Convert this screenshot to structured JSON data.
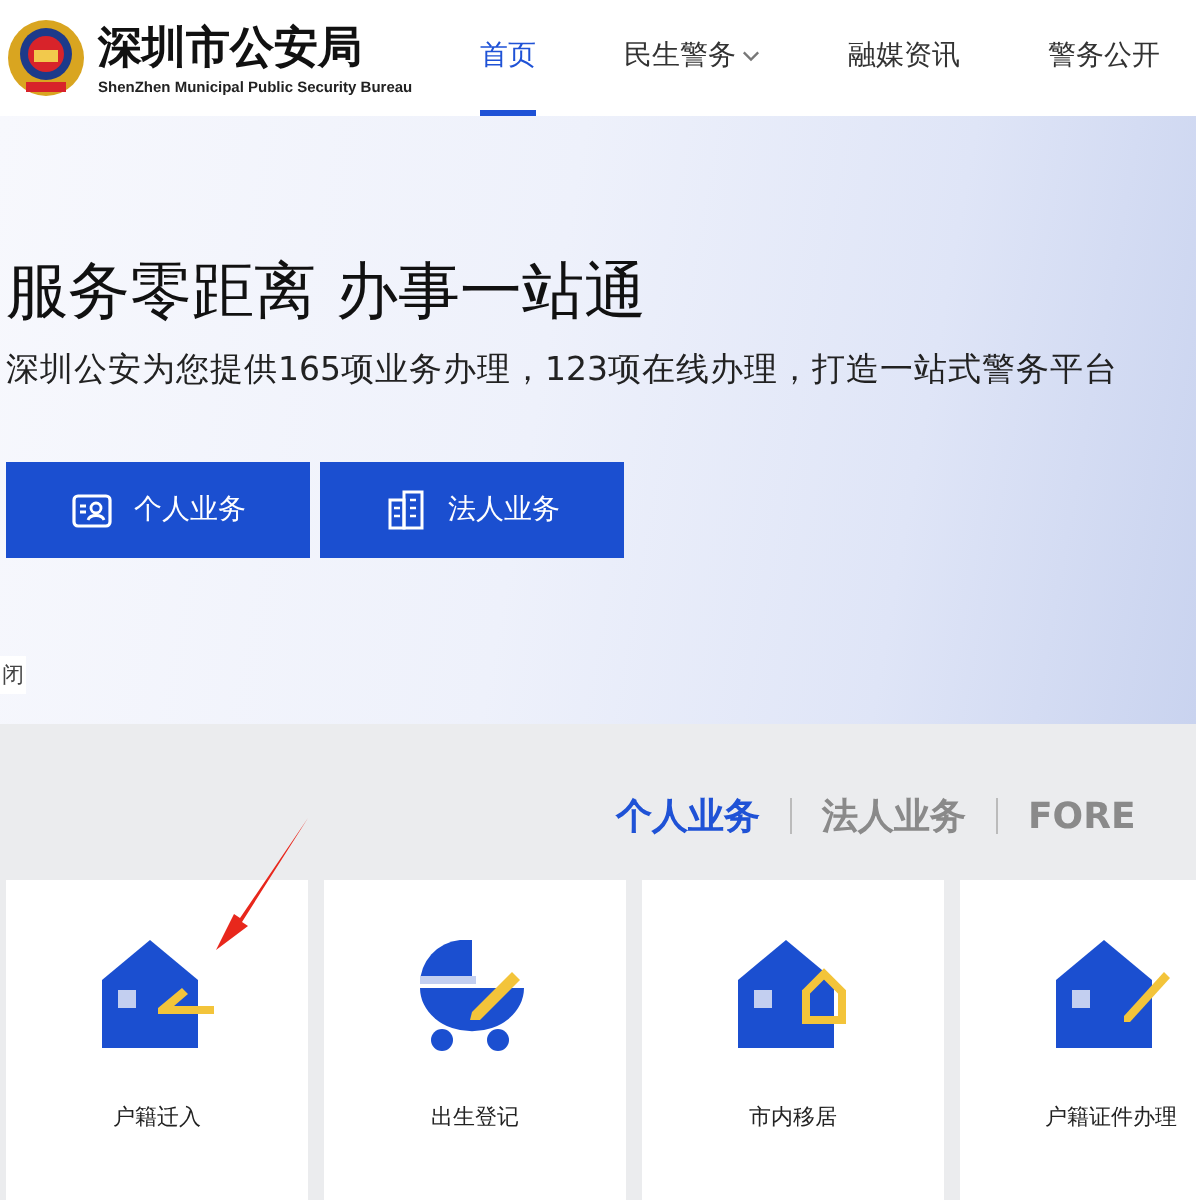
{
  "header": {
    "title": "深圳市公安局",
    "subtitle": "ShenZhen Municipal Public Security Bureau",
    "nav": [
      {
        "label": "首页",
        "selected": true,
        "has_dropdown": false
      },
      {
        "label": "民生警务",
        "selected": false,
        "has_dropdown": true
      },
      {
        "label": "融媒资讯",
        "selected": false,
        "has_dropdown": false
      },
      {
        "label": "警务公开",
        "selected": false,
        "has_dropdown": false
      }
    ]
  },
  "hero": {
    "headline": "服务零距离 办事一站通",
    "tagline": "深圳公安为您提供165项业务办理，123项在线办理，打造一站式警务平台",
    "buttons": [
      {
        "label": "个人业务",
        "kind": "person"
      },
      {
        "label": "法人业务",
        "kind": "building"
      }
    ],
    "close_label": "闭"
  },
  "services": {
    "tabs": [
      {
        "label": "个人业务",
        "selected": true
      },
      {
        "label": "法人业务",
        "selected": false
      },
      {
        "label": "FORE",
        "selected": false
      }
    ],
    "cards": [
      {
        "label": "户籍迁入",
        "kind": "move-in"
      },
      {
        "label": "出生登记",
        "kind": "birth"
      },
      {
        "label": "市内移居",
        "kind": "relocate"
      },
      {
        "label": "户籍证件办理",
        "kind": "certificate"
      }
    ]
  }
}
